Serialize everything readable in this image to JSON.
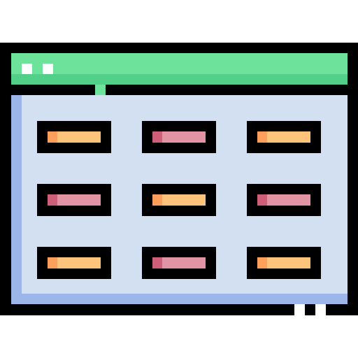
{
  "icon": {
    "name": "web-page-grid-layout-icon",
    "colors": {
      "outline": "#000000",
      "titlebar": "#6de29a",
      "titlebar_highlight": "#52d08a",
      "window_body": "#d3e0f1",
      "window_shadow": "#9db6ea",
      "window_dot": "#ffffff",
      "bar_orange": "#ffc47c",
      "bar_orange_accent": "#ff9f5c",
      "bar_pink": "#e194a4",
      "bar_pink_accent": "#cf5e78"
    },
    "tiles": [
      {
        "row": 0,
        "col": 0,
        "variant": "orange"
      },
      {
        "row": 0,
        "col": 1,
        "variant": "pink"
      },
      {
        "row": 0,
        "col": 2,
        "variant": "orange"
      },
      {
        "row": 1,
        "col": 0,
        "variant": "pink"
      },
      {
        "row": 1,
        "col": 1,
        "variant": "orange"
      },
      {
        "row": 1,
        "col": 2,
        "variant": "pink"
      },
      {
        "row": 2,
        "col": 0,
        "variant": "orange"
      },
      {
        "row": 2,
        "col": 1,
        "variant": "pink"
      },
      {
        "row": 2,
        "col": 2,
        "variant": "orange"
      }
    ]
  }
}
